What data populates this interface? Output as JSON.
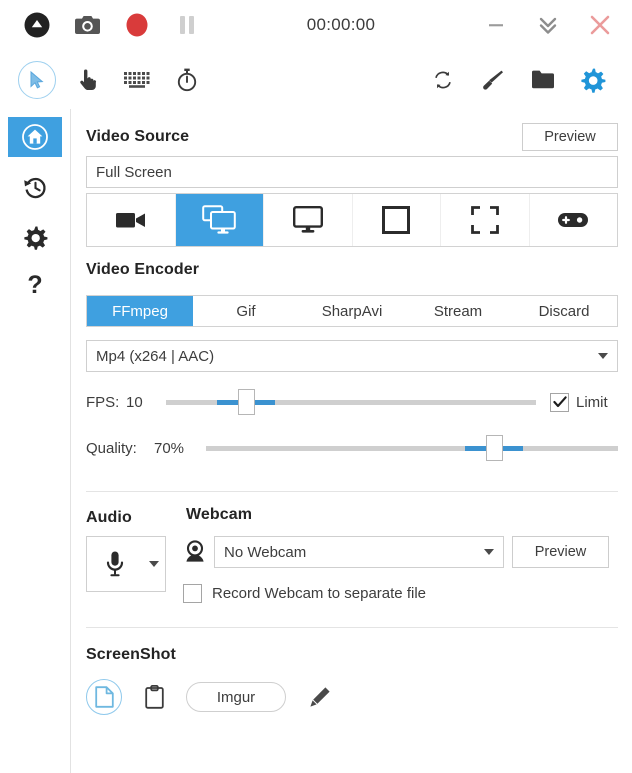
{
  "accent": "#3fa0e0",
  "record_red": "#d93b3b",
  "titlebar": {
    "timer": "00:00:00",
    "buttons": [
      {
        "name": "collapse-up-button",
        "icon": "triangle-up-circle-icon"
      },
      {
        "name": "screenshot-button",
        "icon": "camera-icon"
      },
      {
        "name": "record-button",
        "icon": "record-dot-icon"
      },
      {
        "name": "pause-button",
        "icon": "pause-icon"
      }
    ],
    "window_buttons": [
      {
        "name": "minimize-button",
        "icon": "minimize-icon"
      },
      {
        "name": "collapse-button",
        "icon": "chevron-double-down-icon"
      },
      {
        "name": "close-button",
        "icon": "close-icon"
      }
    ]
  },
  "toolbar": {
    "left": [
      {
        "name": "cursor-toggle-button",
        "icon": "mouse-cursor-icon",
        "selected": true
      },
      {
        "name": "click-toggle-button",
        "icon": "hand-pointer-icon",
        "selected": false
      },
      {
        "name": "keystroke-toggle-button",
        "icon": "keyboard-icon",
        "selected": false
      },
      {
        "name": "timer-button",
        "icon": "stopwatch-icon",
        "selected": false
      }
    ],
    "right": [
      {
        "name": "refresh-button",
        "icon": "refresh-icon"
      },
      {
        "name": "theme-brush-button",
        "icon": "paintbrush-icon"
      },
      {
        "name": "open-folder-button",
        "icon": "folder-icon"
      },
      {
        "name": "settings-button",
        "icon": "gear-icon"
      }
    ]
  },
  "sidebar": {
    "items": [
      {
        "name": "sidebar-item-home",
        "icon": "home-icon",
        "active": true
      },
      {
        "name": "sidebar-item-recent",
        "icon": "history-icon",
        "active": false
      },
      {
        "name": "sidebar-item-configure",
        "icon": "gear-icon",
        "active": false
      },
      {
        "name": "sidebar-item-about",
        "icon": "question-mark-icon",
        "active": false
      }
    ]
  },
  "video_source": {
    "title": "Video Source",
    "preview_label": "Preview",
    "selected_value": "Full Screen",
    "modes": [
      {
        "name": "source-mode-nocapture",
        "icon": "video-camera-icon",
        "active": false
      },
      {
        "name": "source-mode-screen",
        "icon": "screen-duplicate-icon",
        "active": true
      },
      {
        "name": "source-mode-monitor",
        "icon": "monitor-icon",
        "active": false
      },
      {
        "name": "source-mode-window",
        "icon": "window-square-icon",
        "active": false
      },
      {
        "name": "source-mode-region",
        "icon": "region-crop-icon",
        "active": false
      },
      {
        "name": "source-mode-game",
        "icon": "gamepad-icon",
        "active": false
      }
    ]
  },
  "video_encoder": {
    "title": "Video Encoder",
    "tabs": [
      {
        "label": "FFmpeg",
        "active": true
      },
      {
        "label": "Gif",
        "active": false
      },
      {
        "label": "SharpAvi",
        "active": false
      },
      {
        "label": "Stream",
        "active": false
      },
      {
        "label": "Discard",
        "active": false
      }
    ],
    "format_value": "Mp4 (x264 | AAC)",
    "fps": {
      "label": "FPS:",
      "value": "10",
      "percent": 21.5,
      "limit_label": "Limit",
      "limit_checked": true
    },
    "quality": {
      "label": "Quality:",
      "value": "70%",
      "percent": 70
    }
  },
  "audio": {
    "title": "Audio",
    "device_icon": "microphone-icon"
  },
  "webcam": {
    "title": "Webcam",
    "icon": "webcam-icon",
    "selected_value": "No Webcam",
    "preview_label": "Preview",
    "separate_file_label": "Record Webcam to separate file",
    "separate_file_checked": false
  },
  "screenshot": {
    "title": "ScreenShot",
    "targets": [
      {
        "name": "screenshot-target-disk",
        "icon": "file-document-icon",
        "active": true
      },
      {
        "name": "screenshot-target-clipboard",
        "icon": "clipboard-icon",
        "active": false
      }
    ],
    "imgur_label": "Imgur",
    "edit_icon": "pencil-icon"
  }
}
